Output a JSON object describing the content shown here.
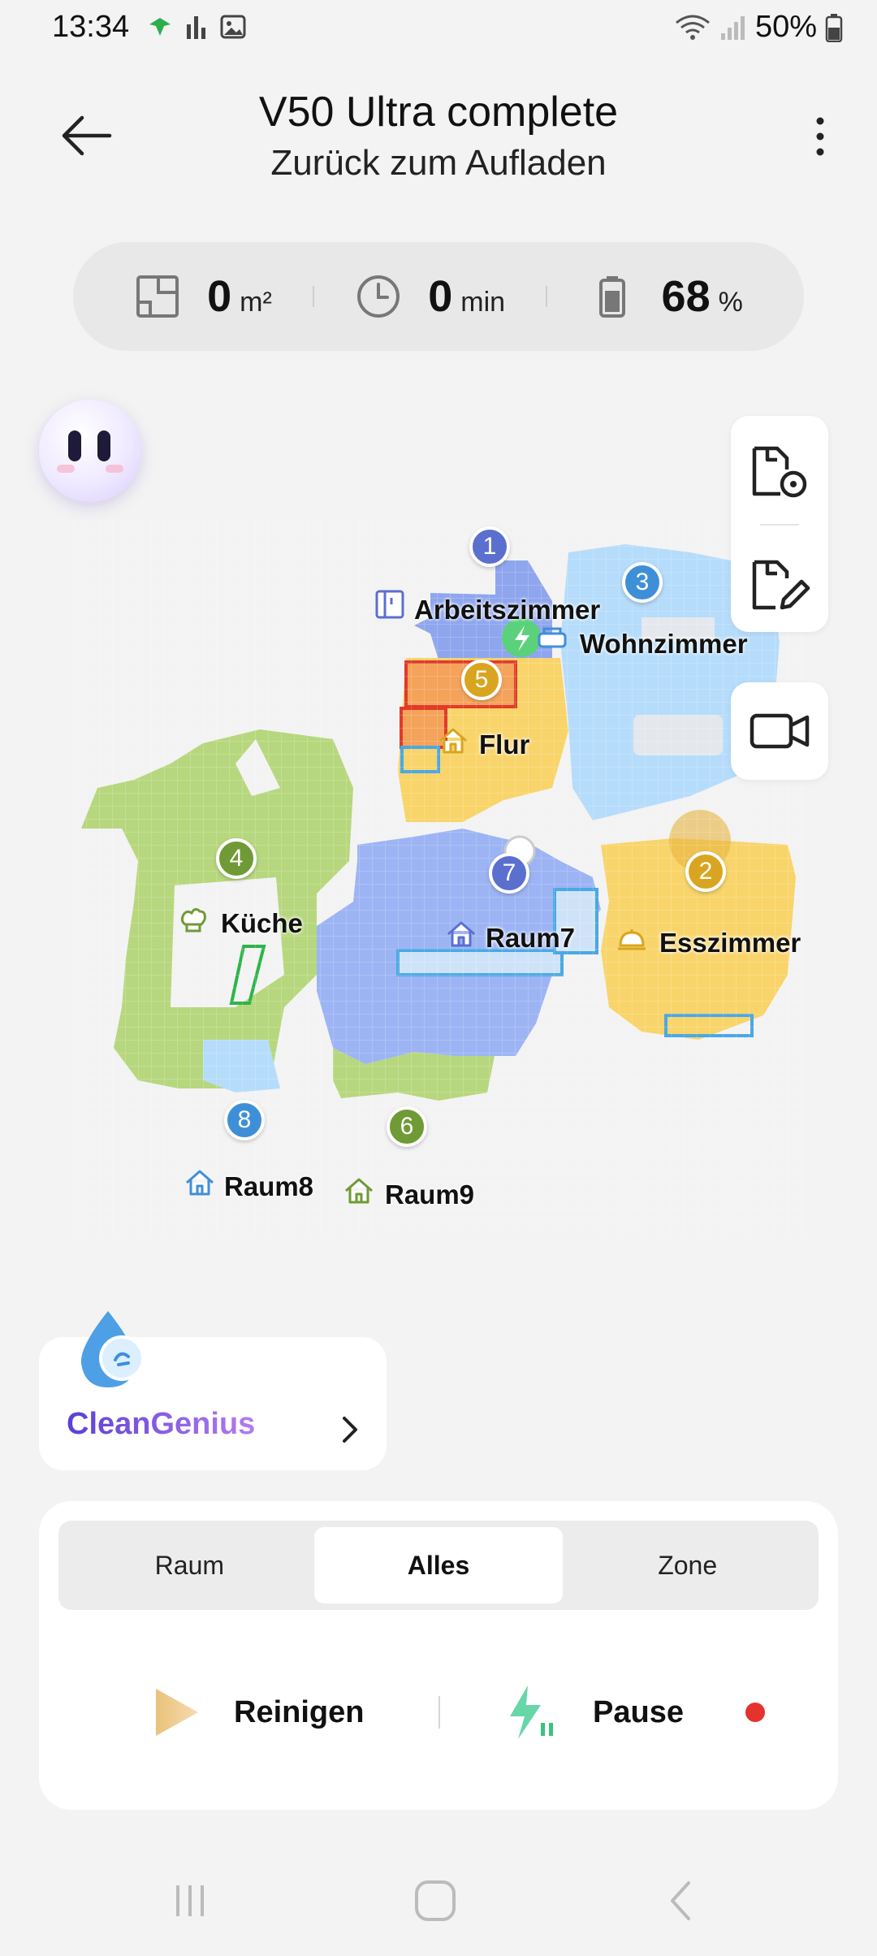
{
  "status_bar": {
    "time": "13:34",
    "battery_text": "50%",
    "icons": [
      "vpn-shield-icon",
      "activity-icon",
      "gallery-icon",
      "wifi-icon",
      "signal-icon",
      "battery-icon"
    ]
  },
  "header": {
    "title": "V50 Ultra complete",
    "subtitle": "Zurück zum Aufladen",
    "back_icon": "arrow-left-icon",
    "menu_icon": "more-vertical-icon"
  },
  "stats": {
    "area_value": "0",
    "area_unit": "m²",
    "time_value": "0",
    "time_unit": "min",
    "battery_value": "68",
    "battery_unit": "%"
  },
  "map": {
    "rooms": [
      {
        "number": "1",
        "name": "Arbeitszimmer",
        "color": "#8fa6ee",
        "badge_color": "#5b6fcf",
        "icon": "desk-icon"
      },
      {
        "number": "3",
        "name": "Wohnzimmer",
        "color": "#b6dcfb",
        "badge_color": "#3f8fd8",
        "icon": "sofa-icon"
      },
      {
        "number": "5",
        "name": "Flur",
        "color": "#f8d46a",
        "badge_color": "#d9a520",
        "icon": "house-icon"
      },
      {
        "number": "4",
        "name": "Küche",
        "color": "#b7d77e",
        "badge_color": "#6f9a35",
        "icon": "chef-hat-icon"
      },
      {
        "number": "7",
        "name": "Raum7",
        "color": "#9db4f4",
        "badge_color": "#5b6fcf",
        "icon": "house-icon"
      },
      {
        "number": "2",
        "name": "Esszimmer",
        "color": "#f8d46a",
        "badge_color": "#d9a520",
        "icon": "dish-cloche-icon"
      },
      {
        "number": "8",
        "name": "Raum8",
        "color": "#b6dcfb",
        "badge_color": "#3f8fd8",
        "icon": "house-icon"
      },
      {
        "number": "6",
        "name": "Raum9",
        "color": "#b7d77e",
        "badge_color": "#6f9a35",
        "icon": "house-icon"
      }
    ]
  },
  "cleangenius": {
    "label": "CleanGenius"
  },
  "modes": {
    "tabs": [
      "Raum",
      "Alles",
      "Zone"
    ],
    "active": "Alles"
  },
  "actions": {
    "clean_label": "Reinigen",
    "pause_label": "Pause"
  }
}
